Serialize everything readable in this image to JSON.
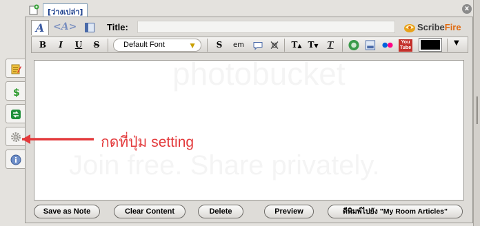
{
  "tabbar": {
    "doc_tab_label": "[ว่างเปล่า]",
    "close_label": "x"
  },
  "editor_header": {
    "mode_visual": "A",
    "mode_html": "<A>",
    "title_label": "Title:",
    "title_value": "",
    "brand_left": "Scribe",
    "brand_right": "Fire"
  },
  "toolbar": {
    "bold": "B",
    "italic": "I",
    "underline": "U",
    "strike": "S",
    "font_select": "Default Font",
    "spell": "S",
    "em": "em",
    "text_bigger": "T",
    "text_smaller": "T",
    "clear_format": "T",
    "youtube_top": "You",
    "youtube_bottom": "Tube",
    "text_color_hex": "#000000"
  },
  "annotation": {
    "text": "กดที่ปุ่ม setting",
    "color": "#e3393b"
  },
  "watermark": {
    "line1": "photobucket",
    "line2": "Join free. Share privately."
  },
  "buttons": {
    "save_as_note": "Save as Note",
    "clear_content": "Clear Content",
    "delete": "Delete",
    "preview": "Preview",
    "publish": "ตีพิมพ์ไปยัง \"My Room Articles\""
  },
  "colors": {
    "brand_orange": "#e06a10",
    "link_blue": "#1a3e8c"
  }
}
